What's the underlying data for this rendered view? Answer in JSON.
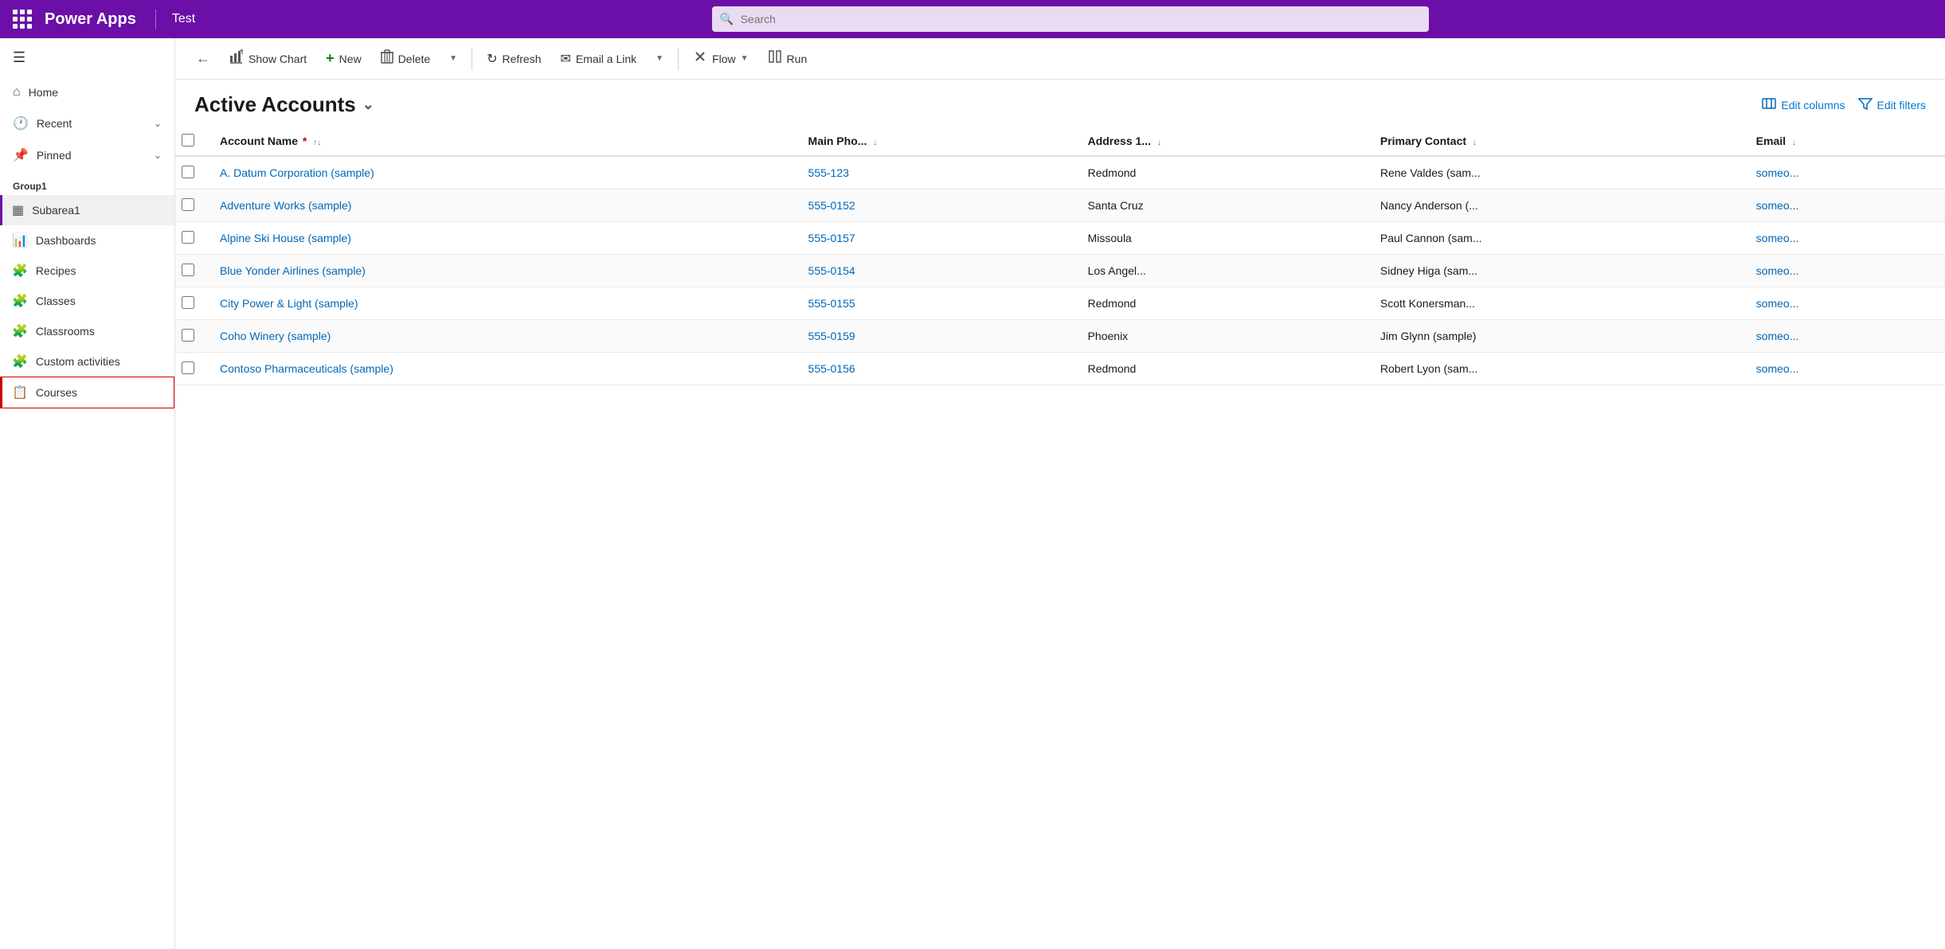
{
  "topbar": {
    "logo": "Power Apps",
    "app_name": "Test",
    "search_placeholder": "Search"
  },
  "toolbar": {
    "back_label": "←",
    "show_chart_label": "Show Chart",
    "new_label": "New",
    "delete_label": "Delete",
    "refresh_label": "Refresh",
    "email_link_label": "Email a Link",
    "flow_label": "Flow",
    "run_label": "Run"
  },
  "list": {
    "title": "Active Accounts",
    "edit_columns_label": "Edit columns",
    "edit_filters_label": "Edit filters"
  },
  "table": {
    "columns": [
      {
        "label": "Account Name",
        "required": true,
        "sort": true
      },
      {
        "label": "Main Pho...",
        "sort": true
      },
      {
        "label": "Address 1...",
        "sort": true
      },
      {
        "label": "Primary Contact",
        "sort": true
      },
      {
        "label": "Email",
        "sort": true
      }
    ],
    "rows": [
      {
        "account_name": "A. Datum Corporation (sample)",
        "main_phone": "555-123",
        "address": "Redmond",
        "primary_contact": "Rene Valdes (sam...",
        "email": "someo..."
      },
      {
        "account_name": "Adventure Works (sample)",
        "main_phone": "555-0152",
        "address": "Santa Cruz",
        "primary_contact": "Nancy Anderson (...",
        "email": "someo..."
      },
      {
        "account_name": "Alpine Ski House (sample)",
        "main_phone": "555-0157",
        "address": "Missoula",
        "primary_contact": "Paul Cannon (sam...",
        "email": "someo..."
      },
      {
        "account_name": "Blue Yonder Airlines (sample)",
        "main_phone": "555-0154",
        "address": "Los Angel...",
        "primary_contact": "Sidney Higa (sam...",
        "email": "someo..."
      },
      {
        "account_name": "City Power & Light (sample)",
        "main_phone": "555-0155",
        "address": "Redmond",
        "primary_contact": "Scott Konersman...",
        "email": "someo..."
      },
      {
        "account_name": "Coho Winery (sample)",
        "main_phone": "555-0159",
        "address": "Phoenix",
        "primary_contact": "Jim Glynn (sample)",
        "email": "someo..."
      },
      {
        "account_name": "Contoso Pharmaceuticals (sample)",
        "main_phone": "555-0156",
        "address": "Redmond",
        "primary_contact": "Robert Lyon (sam...",
        "email": "someo..."
      }
    ]
  },
  "sidebar": {
    "nav_items": [
      {
        "label": "Home",
        "icon": "⌂"
      },
      {
        "label": "Recent",
        "icon": "🕐",
        "has_chevron": true
      },
      {
        "label": "Pinned",
        "icon": "📌",
        "has_chevron": true
      }
    ],
    "group_title": "Group1",
    "sub_items": [
      {
        "label": "Subarea1",
        "icon": "▦",
        "active": true
      },
      {
        "label": "Dashboards",
        "icon": "📊"
      },
      {
        "label": "Recipes",
        "icon": "🧩"
      },
      {
        "label": "Classes",
        "icon": "🧩"
      },
      {
        "label": "Classrooms",
        "icon": "🧩"
      },
      {
        "label": "Custom activities",
        "icon": "🧩"
      },
      {
        "label": "Courses",
        "icon": "📋",
        "highlighted": true
      }
    ]
  },
  "colors": {
    "purple": "#6b0fa8",
    "blue_link": "#0067b8",
    "active_border": "#6b0fa8",
    "highlight_border": "#cc0000"
  }
}
